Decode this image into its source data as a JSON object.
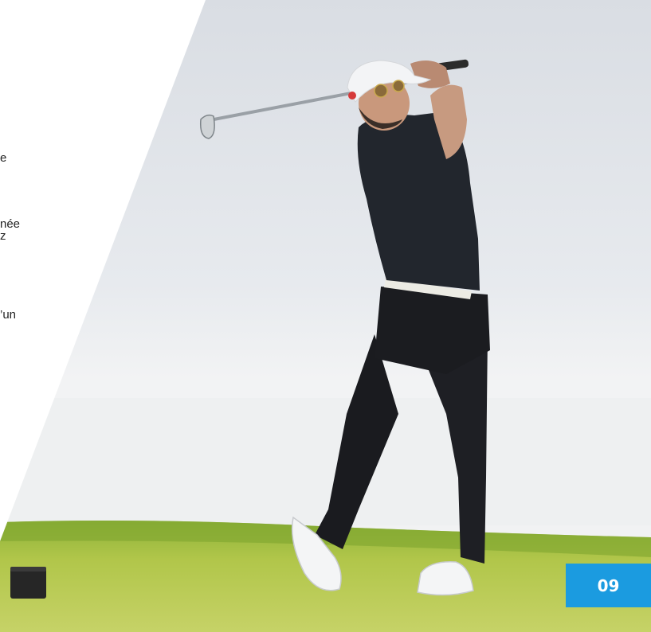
{
  "text_fragments": [
    "e",
    "née",
    "z",
    "’un"
  ],
  "page_number": "09",
  "colors": {
    "badge": "#1b9be0",
    "sky": "#e9ecf0",
    "grass": "#a9c23f",
    "shirt": "#22262d",
    "pants": "#1a1b1f"
  }
}
